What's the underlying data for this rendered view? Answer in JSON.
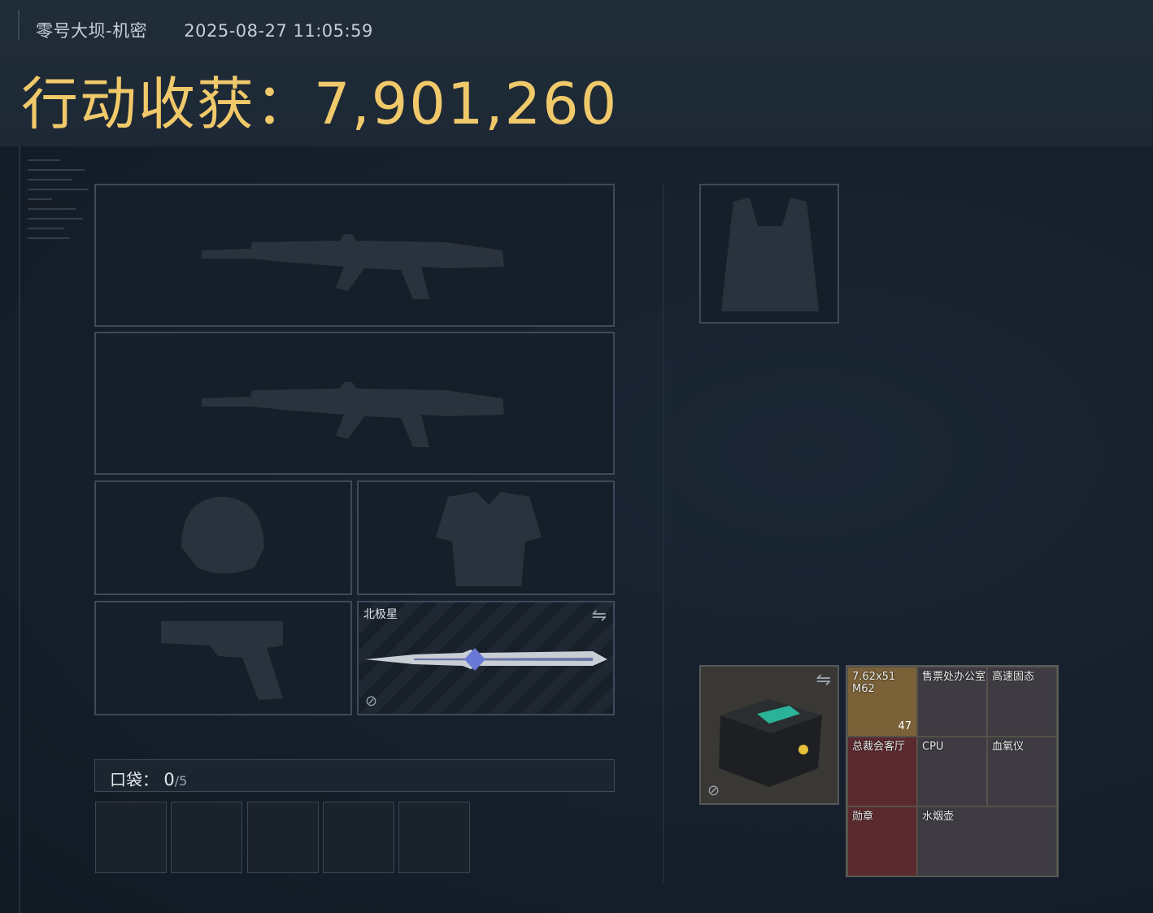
{
  "header": {
    "map_name": "零号大坝-机密",
    "datetime": "2025-08-27 11:05:59",
    "title": "行动收获：7,901,260"
  },
  "loadout": {
    "primary_weapon_1": "rifle-silhouette",
    "primary_weapon_2": "rifle-silhouette",
    "helmet": "helmet-silhouette",
    "body_armor": "armor-silhouette",
    "sidearm": "pistol-silhouette",
    "melee": {
      "label": "北极星"
    },
    "chest_rig": "vest-silhouette"
  },
  "pocket": {
    "label": "口袋：",
    "current": "0",
    "max": "/5",
    "slots": 5
  },
  "backpack": {
    "case_icon": "safe-box-icon",
    "items": [
      {
        "name": "7.62x51 M62",
        "qty": "47",
        "color": "#7a6138"
      },
      {
        "name": "售票处办公室",
        "qty": "",
        "color": "#3e3c42"
      },
      {
        "name": "高速固态",
        "qty": "",
        "color": "#3e3c42"
      },
      {
        "name": "总裁会客厅",
        "qty": "",
        "color": "#5a2a2e"
      },
      {
        "name": "CPU",
        "qty": "",
        "color": "#3e3c42"
      },
      {
        "name": "血氧仪",
        "qty": "",
        "color": "#3e3c42"
      },
      {
        "name": "勋章",
        "qty": "",
        "color": "#5a2a2e"
      },
      {
        "name": "水烟壶",
        "qty": "",
        "color": "#3e3c42"
      }
    ]
  }
}
